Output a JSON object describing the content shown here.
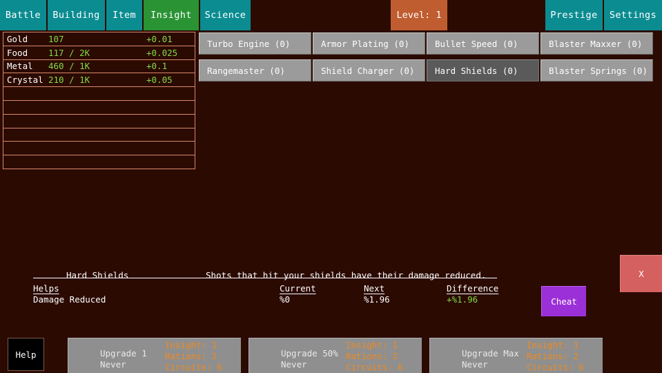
{
  "nav": {
    "tabs": [
      {
        "label": "Battle",
        "active": false
      },
      {
        "label": "Building",
        "active": false
      },
      {
        "label": "Item",
        "active": false
      },
      {
        "label": "Insight",
        "active": true
      },
      {
        "label": "Science",
        "active": false
      }
    ],
    "right_tabs": [
      {
        "label": "Prestige"
      },
      {
        "label": "Settings"
      }
    ],
    "level_badge": "Level: 1"
  },
  "colors": {
    "background": "#2b0a02",
    "tab": "#0b8c91",
    "tab_active": "#2a9434",
    "level_badge": "#bf5c30",
    "resource_border": "#d98a6a",
    "resource_value": "#83d94a",
    "button": "#9b9b9b",
    "button_selected": "#5a5a5a",
    "cost_text": "#f08a1e",
    "cheat": "#9b30d9",
    "close": "#d4605f"
  },
  "resources": {
    "rows": [
      {
        "name": "Gold",
        "amount": "107",
        "rate": "+0.01"
      },
      {
        "name": "Food",
        "amount": "117 / 2K",
        "rate": "+0.025"
      },
      {
        "name": "Metal",
        "amount": "460 / 1K",
        "rate": "+0.1"
      },
      {
        "name": "Crystal",
        "amount": "210 / 1K",
        "rate": "+0.05"
      },
      {
        "name": "",
        "amount": "",
        "rate": ""
      },
      {
        "name": "",
        "amount": "",
        "rate": ""
      },
      {
        "name": "",
        "amount": "",
        "rate": ""
      },
      {
        "name": "",
        "amount": "",
        "rate": ""
      },
      {
        "name": "",
        "amount": "",
        "rate": ""
      },
      {
        "name": "",
        "amount": "",
        "rate": ""
      }
    ]
  },
  "upgrades": {
    "items": [
      {
        "label": "Turbo Engine (0)",
        "selected": false
      },
      {
        "label": "Armor Plating (0)",
        "selected": false
      },
      {
        "label": "Bullet Speed (0)",
        "selected": false
      },
      {
        "label": "Blaster Maxxer (0)",
        "selected": false
      },
      {
        "label": "Rangemaster (0)",
        "selected": false
      },
      {
        "label": "Shield Charger (0)",
        "selected": false
      },
      {
        "label": "Hard Shields (0)",
        "selected": true
      },
      {
        "label": "Blaster Springs (0)",
        "selected": false
      }
    ]
  },
  "detail": {
    "title": "Hard Shields",
    "description": "Shots that hit your shields have their damage reduced.",
    "headers": {
      "helps": "Helps",
      "current": "Current",
      "next": "Next",
      "difference": "Difference"
    },
    "row": {
      "helps": "Damage Reduced",
      "current": "%0",
      "next": "%1.96",
      "difference": "+%1.96"
    }
  },
  "actions": {
    "cheat_label": "Cheat",
    "close_label": "X",
    "help_label": "Help"
  },
  "purchase": {
    "buttons": [
      {
        "label": "Upgrade 1",
        "sub": "Never",
        "costs": [
          "Insight: 1",
          "Rations: 2",
          "Circuits: 6"
        ]
      },
      {
        "label": "Upgrade 50%",
        "sub": "Never",
        "costs": [
          "Insight: 1",
          "Rations: 2",
          "Circuits: 6"
        ]
      },
      {
        "label": "Upgrade Max",
        "sub": "Never",
        "costs": [
          "Insight: 1",
          "Rations: 2",
          "Circuits: 6"
        ]
      }
    ]
  }
}
